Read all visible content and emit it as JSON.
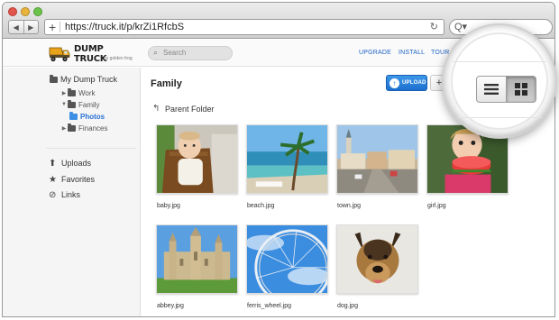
{
  "browser": {
    "url": "https://truck.it/p/krZi1RfcbS",
    "nav_back": "◀",
    "nav_forward": "▶",
    "new_tab": "+",
    "reload": "↻",
    "search_glyph": "Q▾"
  },
  "app": {
    "brand": "DUMP TRUCK",
    "tagline": "by golden frog",
    "search_placeholder": "Search",
    "nav": [
      "UPGRADE",
      "INSTALL",
      "TOUR"
    ],
    "accent": "#1e62c5"
  },
  "sidebar": {
    "root": "My Dump Truck",
    "tree": [
      {
        "label": "Work",
        "expanded": false
      },
      {
        "label": "Family",
        "expanded": true
      },
      {
        "label": "Photos",
        "selected": true
      },
      {
        "label": "Finances",
        "expanded": false
      }
    ],
    "links": [
      {
        "label": "Uploads",
        "icon": "upload-icon"
      },
      {
        "label": "Favorites",
        "icon": "star-icon"
      },
      {
        "label": "Links",
        "icon": "link-icon"
      }
    ]
  },
  "main": {
    "title": "Family",
    "upload_label": "UPLOAD",
    "new_label": "+",
    "partial_label": "R",
    "parent_folder": "Parent Folder",
    "files": [
      {
        "name": "baby.jpg"
      },
      {
        "name": "beach.jpg"
      },
      {
        "name": "town.jpg"
      },
      {
        "name": "girl.jpg"
      },
      {
        "name": "abbey.jpg"
      },
      {
        "name": "ferris_wheel.jpg"
      },
      {
        "name": "dog.jpg"
      }
    ]
  },
  "view_toggle": {
    "options": [
      "list",
      "grid"
    ],
    "selected": "grid"
  }
}
